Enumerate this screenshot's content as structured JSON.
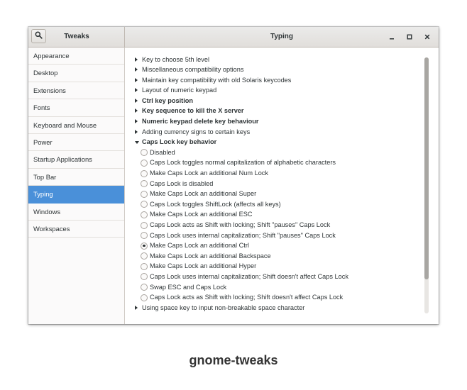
{
  "window": {
    "app_title": "Tweaks",
    "page_title": "Typing",
    "controls": {
      "minimize": "minimize-icon",
      "maximize": "maximize-icon",
      "close": "close-icon"
    }
  },
  "sidebar": {
    "items": [
      {
        "label": "Appearance",
        "selected": false
      },
      {
        "label": "Desktop",
        "selected": false
      },
      {
        "label": "Extensions",
        "selected": false
      },
      {
        "label": "Fonts",
        "selected": false
      },
      {
        "label": "Keyboard and Mouse",
        "selected": false
      },
      {
        "label": "Power",
        "selected": false
      },
      {
        "label": "Startup Applications",
        "selected": false
      },
      {
        "label": "Top Bar",
        "selected": false
      },
      {
        "label": "Typing",
        "selected": true
      },
      {
        "label": "Windows",
        "selected": false
      },
      {
        "label": "Workspaces",
        "selected": false
      }
    ]
  },
  "options": {
    "sections_before": [
      {
        "label": "Key to choose 5th level",
        "bold": false
      },
      {
        "label": "Miscellaneous compatibility options",
        "bold": false
      },
      {
        "label": "Maintain key compatibility with old Solaris keycodes",
        "bold": false
      },
      {
        "label": "Layout of numeric keypad",
        "bold": false
      },
      {
        "label": "Ctrl key position",
        "bold": true
      },
      {
        "label": "Key sequence to kill the X server",
        "bold": true
      },
      {
        "label": "Numeric keypad delete key behaviour",
        "bold": true
      },
      {
        "label": "Adding currency signs to certain keys",
        "bold": false
      }
    ],
    "expanded_section": {
      "label": "Caps Lock key behavior",
      "bold": true
    },
    "caps_lock_choices": [
      {
        "label": "Disabled",
        "checked": false
      },
      {
        "label": "Caps Lock toggles normal capitalization of alphabetic characters",
        "checked": false
      },
      {
        "label": "Make Caps Lock an additional Num Lock",
        "checked": false
      },
      {
        "label": "Caps Lock is disabled",
        "checked": false
      },
      {
        "label": "Make Caps Lock an additional Super",
        "checked": false
      },
      {
        "label": "Caps Lock toggles ShiftLock (affects all keys)",
        "checked": false
      },
      {
        "label": "Make Caps Lock an additional ESC",
        "checked": false
      },
      {
        "label": "Caps Lock acts as Shift with locking; Shift \"pauses\" Caps Lock",
        "checked": false
      },
      {
        "label": "Caps Lock uses internal capitalization; Shift \"pauses\" Caps Lock",
        "checked": false
      },
      {
        "label": "Make Caps Lock an additional Ctrl",
        "checked": true
      },
      {
        "label": "Make Caps Lock an additional Backspace",
        "checked": false
      },
      {
        "label": "Make Caps Lock an additional Hyper",
        "checked": false
      },
      {
        "label": "Caps Lock uses internal capitalization; Shift doesn't affect Caps Lock",
        "checked": false
      },
      {
        "label": "Swap ESC and Caps Lock",
        "checked": false
      },
      {
        "label": "Caps Lock acts as Shift with locking; Shift doesn't affect Caps Lock",
        "checked": false
      }
    ],
    "sections_after": [
      {
        "label": "Using space key to input non-breakable space character",
        "bold": false
      }
    ]
  },
  "caption": "gnome-tweaks",
  "colors": {
    "selection": "#4a90d9",
    "headerbar": "#e1dedb",
    "sidebar": "#fbfafa"
  }
}
